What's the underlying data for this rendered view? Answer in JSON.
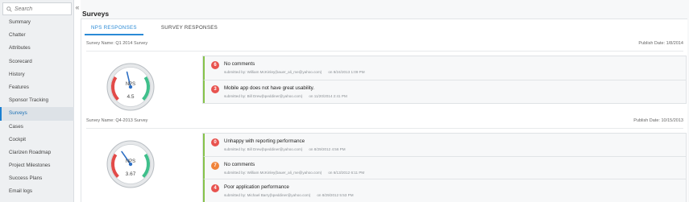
{
  "sidebar": {
    "search_placeholder": "Search",
    "collapse_glyph": "«",
    "items": [
      {
        "label": "Summary",
        "active": false
      },
      {
        "label": "Chatter",
        "active": false
      },
      {
        "label": "Attributes",
        "active": false
      },
      {
        "label": "Scorecard",
        "active": false
      },
      {
        "label": "History",
        "active": false
      },
      {
        "label": "Features",
        "active": false
      },
      {
        "label": "Sponsor Tracking",
        "active": false
      },
      {
        "label": "Surveys",
        "active": true
      },
      {
        "label": "Cases",
        "active": false
      },
      {
        "label": "Cockpit",
        "active": false
      },
      {
        "label": "Clarizen Roadmap",
        "active": false
      },
      {
        "label": "Project Milestones",
        "active": false
      },
      {
        "label": "Success Plans",
        "active": false
      },
      {
        "label": "Email logs",
        "active": false
      }
    ]
  },
  "main": {
    "title": "Surveys",
    "tabs": [
      {
        "label": "NPS RESPONSES",
        "active": true
      },
      {
        "label": "SURVEY RESPONSES",
        "active": false
      }
    ],
    "surveys": [
      {
        "name": "Survey Name: Q1 2014 Survey",
        "publish": "Publish Date: 1/8/2014",
        "gauge": {
          "label": "NPS",
          "value": "4.5",
          "needle_fraction": 0.45
        },
        "comments": [
          {
            "score": "6",
            "color": "red",
            "text": "No comments",
            "submitted_by": "submitted by: William McKinley(bauer_ali_me@yahoo.com)",
            "date": "on 8/24/2013 1:09 PM"
          },
          {
            "score": "3",
            "color": "red",
            "text": "Mobile app does not have great usability.",
            "submitted_by": "submitted by: Bill Drew(bpeddiner@yahoo.com)",
            "date": "on 11/20/2014 2:41 PM"
          }
        ]
      },
      {
        "name": "Survey Name: Q4-2013 Survey",
        "publish": "Publish Date: 10/15/2013",
        "gauge": {
          "label": "NPS",
          "value": "3.67",
          "needle_fraction": 0.37
        },
        "comments": [
          {
            "score": "0",
            "color": "red",
            "text": "Unhappy with reporting performance",
            "submitted_by": "submitted by: Bill Drew(bpeddiner@yahoo.com)",
            "date": "on 8/29/2012 4:56 PM"
          },
          {
            "score": "7",
            "color": "orange",
            "text": "No comments",
            "submitted_by": "submitted by: William McKinley(bauer_ali_me@yahoo.com)",
            "date": "on 6/13/2012 6:11 PM"
          },
          {
            "score": "4",
            "color": "red",
            "text": "Poor application performance",
            "submitted_by": "submitted by: Michael Barry(bpeddiner@yahoo.com)",
            "date": "on 8/29/2012 5:53 PM"
          }
        ]
      }
    ]
  },
  "colors": {
    "accent": "#2a8ad6",
    "badge_red": "#e8534f",
    "badge_orange": "#f0833a",
    "comment_border": "#86c34a"
  }
}
